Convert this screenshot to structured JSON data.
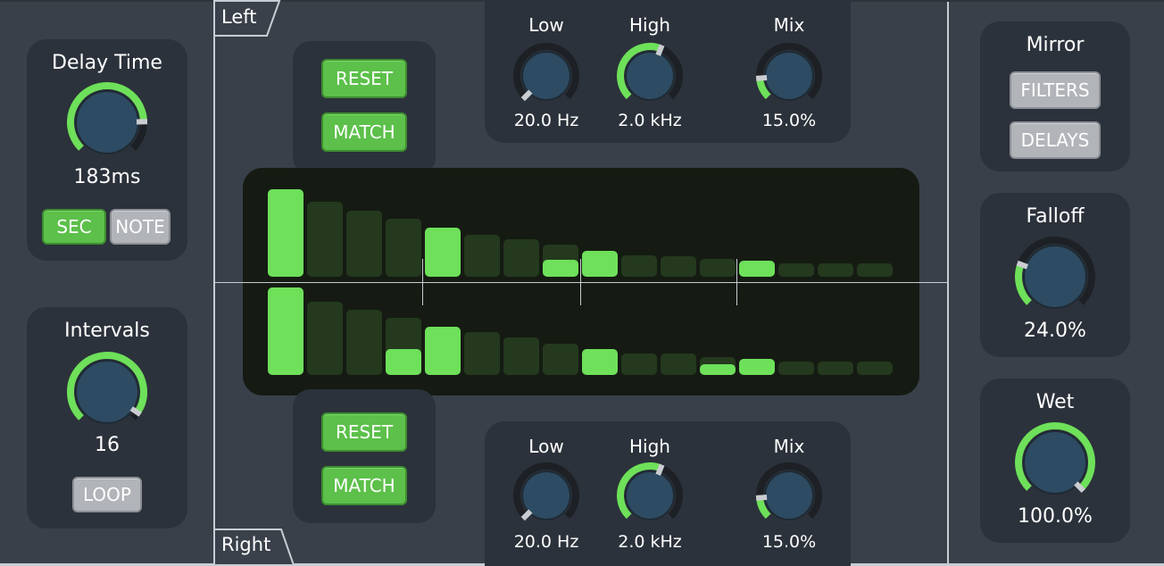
{
  "colors": {
    "accent": "#6ee05a",
    "knob_face": "#2d4b62",
    "knob_ring": "#1d2126",
    "bar_inactive": "#24391e",
    "bar_active": "#6ee05a",
    "display_bg": "#151b13"
  },
  "left_column": {
    "delay_time": {
      "title": "Delay Time",
      "value": "183ms",
      "knob_level": 0.83,
      "buttons": {
        "sec": "SEC",
        "note": "NOTE"
      }
    },
    "intervals": {
      "title": "Intervals",
      "value": "16",
      "knob_level": 0.96,
      "loop": "LOOP"
    }
  },
  "channels": {
    "left": {
      "tab": "Left",
      "reset": "RESET",
      "match": "MATCH",
      "filter": {
        "low": {
          "label": "Low",
          "value": "20.0 Hz",
          "level": 0.0
        },
        "high": {
          "label": "High",
          "value": "2.0 kHz",
          "level": 0.58
        },
        "mix": {
          "label": "Mix",
          "value": "15.0%",
          "level": 0.15
        }
      }
    },
    "right": {
      "tab": "Right",
      "reset": "RESET",
      "match": "MATCH",
      "filter": {
        "low": {
          "label": "Low",
          "value": "20.0 Hz",
          "level": 0.0
        },
        "high": {
          "label": "High",
          "value": "2.0 kHz",
          "level": 0.58
        },
        "mix": {
          "label": "Mix",
          "value": "15.0%",
          "level": 0.15
        }
      }
    }
  },
  "display": {
    "taps_left": [
      {
        "level": 1.0,
        "fill": 1.0
      },
      {
        "level": 0.86,
        "fill": 0.0
      },
      {
        "level": 0.76,
        "fill": 0.0
      },
      {
        "level": 0.66,
        "fill": 0.0
      },
      {
        "level": 0.56,
        "fill": 1.0
      },
      {
        "level": 0.48,
        "fill": 0.0
      },
      {
        "level": 0.43,
        "fill": 0.0
      },
      {
        "level": 0.37,
        "fill": 0.52
      },
      {
        "level": 0.3,
        "fill": 1.0
      },
      {
        "level": 0.25,
        "fill": 0.0
      },
      {
        "level": 0.23,
        "fill": 0.0
      },
      {
        "level": 0.2,
        "fill": 0.0
      },
      {
        "level": 0.18,
        "fill": 1.0
      },
      {
        "level": 0.15,
        "fill": 0.0
      },
      {
        "level": 0.15,
        "fill": 0.0
      },
      {
        "level": 0.15,
        "fill": 0.0
      }
    ],
    "taps_right": [
      {
        "level": 1.0,
        "fill": 1.0
      },
      {
        "level": 0.84,
        "fill": 0.0
      },
      {
        "level": 0.75,
        "fill": 0.0
      },
      {
        "level": 0.65,
        "fill": 0.45
      },
      {
        "level": 0.55,
        "fill": 1.0
      },
      {
        "level": 0.49,
        "fill": 0.0
      },
      {
        "level": 0.43,
        "fill": 0.0
      },
      {
        "level": 0.36,
        "fill": 0.0
      },
      {
        "level": 0.3,
        "fill": 1.0
      },
      {
        "level": 0.25,
        "fill": 0.0
      },
      {
        "level": 0.24,
        "fill": 0.0
      },
      {
        "level": 0.2,
        "fill": 0.6
      },
      {
        "level": 0.18,
        "fill": 1.0
      },
      {
        "level": 0.15,
        "fill": 0.0
      },
      {
        "level": 0.15,
        "fill": 0.0
      },
      {
        "level": 0.15,
        "fill": 0.0
      }
    ]
  },
  "right_column": {
    "mirror": {
      "title": "Mirror",
      "filters": "FILTERS",
      "delays": "DELAYS"
    },
    "falloff": {
      "title": "Falloff",
      "value": "24.0%",
      "knob_level": 0.24
    },
    "wet": {
      "title": "Wet",
      "value": "100.0%",
      "knob_level": 1.0
    }
  }
}
